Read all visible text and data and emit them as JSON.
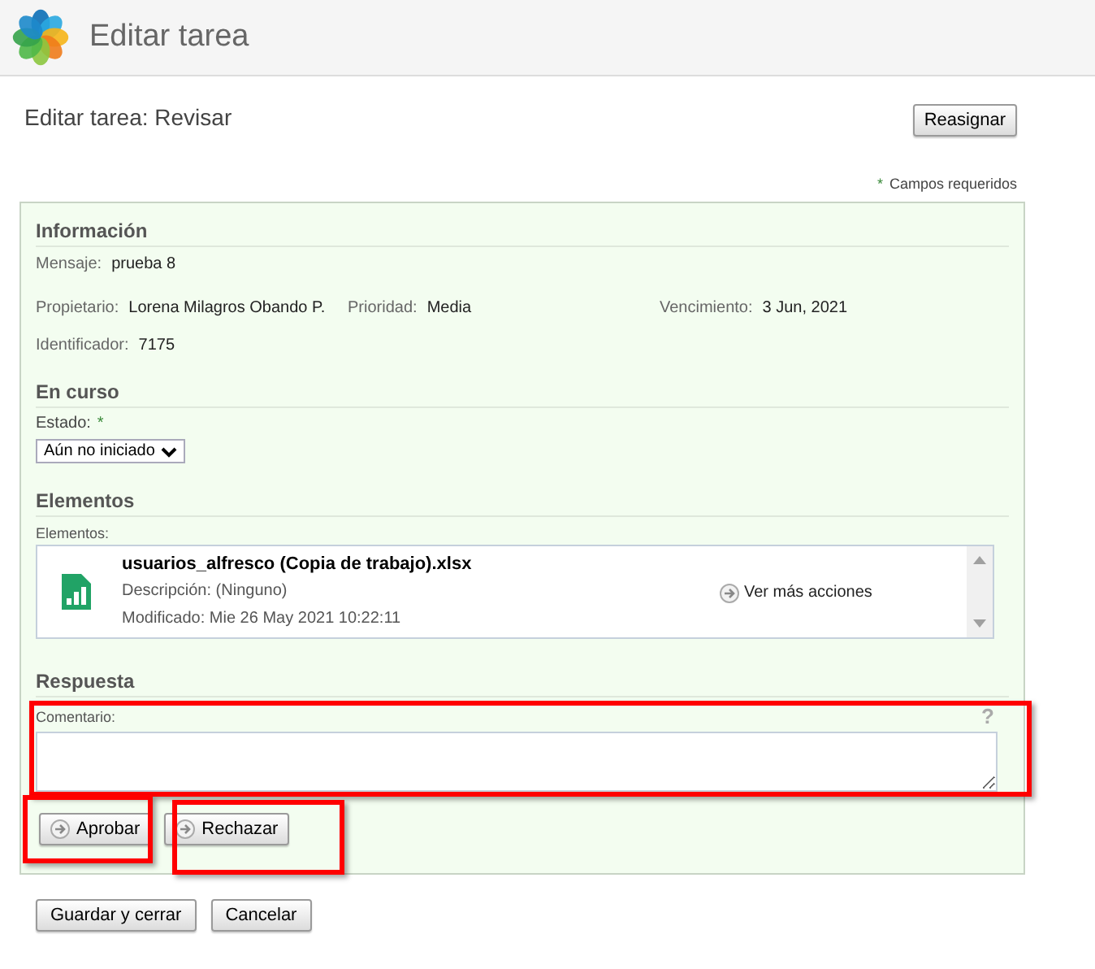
{
  "header": {
    "title": "Editar tarea"
  },
  "page_title": "Editar tarea: Revisar",
  "reassign_button": "Reasignar",
  "required_note": {
    "mark": "*",
    "text": "Campos requeridos"
  },
  "info": {
    "heading": "Información",
    "rows": [
      [
        {
          "label": "Mensaje:",
          "value": "prueba 8"
        }
      ],
      [
        {
          "label": "Propietario:",
          "value": "Lorena Milagros Obando P."
        },
        {
          "label": "Prioridad:",
          "value": "Media"
        },
        {
          "label": "Vencimiento:",
          "value": "3 Jun, 2021"
        }
      ],
      [
        {
          "label": "Identificador:",
          "value": "7175"
        }
      ]
    ]
  },
  "progress": {
    "heading": "En curso",
    "status_label": "Estado:",
    "required_mark": "*",
    "status_value": "Aún no iniciado"
  },
  "items": {
    "heading": "Elementos",
    "label": "Elementos:",
    "files": [
      {
        "name": "usuarios_alfresco (Copia de trabajo).xlsx",
        "description": "Descripción: (Ninguno)",
        "modified": "Modificado: Mie 26 May 2021 10:22:11",
        "action": "Ver más acciones"
      }
    ]
  },
  "response": {
    "heading": "Respuesta",
    "comment_label": "Comentario:",
    "help": "?",
    "buttons": [
      "Aprobar",
      "Rechazar"
    ]
  },
  "footer_buttons": [
    "Guardar y cerrar",
    "Cancelar"
  ],
  "highlight_frames": [
    {
      "kind": "frame"
    },
    {
      "kind": "frame"
    },
    {
      "kind": "frame"
    }
  ]
}
